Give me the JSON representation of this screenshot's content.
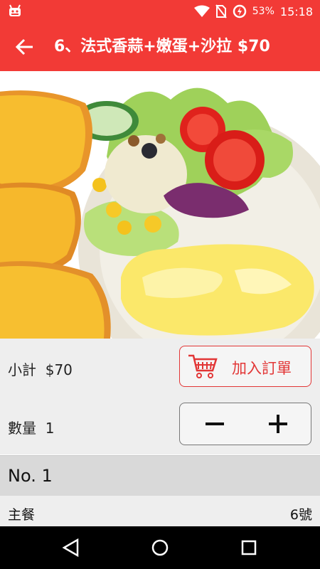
{
  "status_bar": {
    "battery": "53%",
    "time": "15:18",
    "icons": [
      "android-debug-icon",
      "wifi-icon",
      "no-sim-icon",
      "battery-saver-icon"
    ]
  },
  "app_bar": {
    "back_icon": "arrow-left-icon",
    "title": "6、法式香蒜+嫩蛋+沙拉 $70"
  },
  "hero": {
    "subject": "garlic-toast-eggs-salad-photo"
  },
  "subtotal": {
    "label": "小計",
    "value": "$70"
  },
  "add_to_order": {
    "label": "加入訂單",
    "icon": "shopping-cart-icon"
  },
  "quantity": {
    "label": "數量",
    "value": "1",
    "minus_icon": "minus-icon",
    "plus_icon": "plus-icon"
  },
  "order_section": {
    "title": "No. 1"
  },
  "detail": {
    "label": "主餐",
    "value": "6號"
  },
  "nav_bar": {
    "icons": [
      "back-triangle-icon",
      "home-circle-icon",
      "recents-square-icon"
    ]
  },
  "colors": {
    "accent": "#f23a36",
    "button_red": "#e23636",
    "row_bg": "#eeeeee",
    "section_bg": "#d9d9d9"
  }
}
